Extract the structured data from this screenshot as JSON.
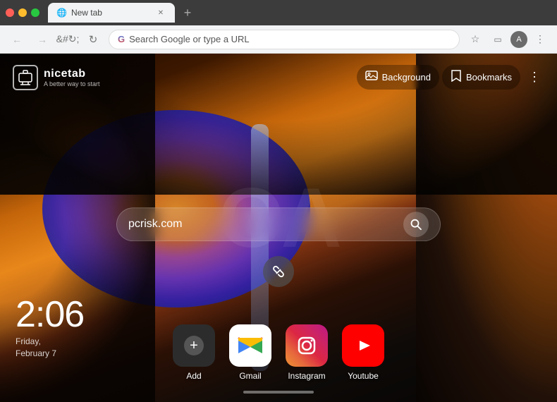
{
  "browser": {
    "tab_title": "New tab",
    "tab_favicon": "🌐",
    "address_placeholder": "Search Google or type a URL",
    "address_value": "Search Google or type a URL"
  },
  "logo": {
    "name": "nicetab",
    "tagline": "A better way to start",
    "icon": "🖥"
  },
  "top_actions": {
    "background_label": "Background",
    "bookmarks_label": "Bookmarks"
  },
  "search": {
    "placeholder": "pcrisk.com",
    "value": "pcrisk.com"
  },
  "time": {
    "hour": "2:06",
    "day": "Friday,",
    "date": "February 7"
  },
  "watermark": "OA",
  "apps": [
    {
      "id": "add",
      "label": "Add",
      "icon_type": "add"
    },
    {
      "id": "gmail",
      "label": "Gmail",
      "icon_type": "gmail"
    },
    {
      "id": "instagram",
      "label": "Instagram",
      "icon_type": "instagram"
    },
    {
      "id": "youtube",
      "label": "Youtube",
      "icon_type": "youtube"
    }
  ],
  "colors": {
    "accent": "#f09433"
  }
}
